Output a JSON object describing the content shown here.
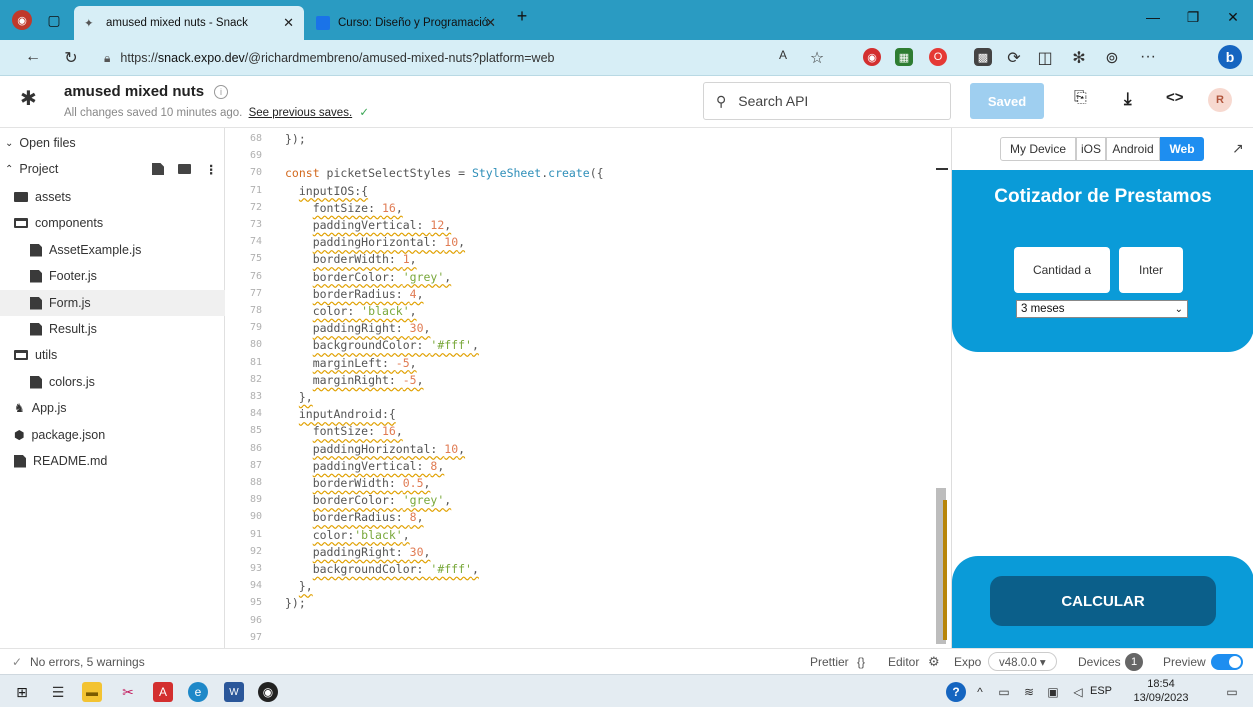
{
  "browser": {
    "tabs": [
      {
        "title": "amused mixed nuts - Snack",
        "active": true
      },
      {
        "title": "Curso: Diseño y Programación de",
        "active": false
      }
    ],
    "new_tab": "+",
    "url_prefix": "https://",
    "url_host": "snack.expo.dev",
    "url_path": "/@richardmembreno/amused-mixed-nuts?platform=web",
    "more": "···"
  },
  "app": {
    "title": "amused mixed nuts",
    "save_status": "All changes saved 10 minutes ago.",
    "see_previous": "See previous saves.",
    "search_placeholder": "Search API",
    "saved_label": "Saved",
    "avatar": "R"
  },
  "sidebar": {
    "open_files": "Open files",
    "project": "Project",
    "items": [
      {
        "label": "assets",
        "kind": "folder"
      },
      {
        "label": "components",
        "kind": "folder-open"
      },
      {
        "label": "AssetExample.js",
        "kind": "file"
      },
      {
        "label": "Footer.js",
        "kind": "file"
      },
      {
        "label": "Form.js",
        "kind": "file",
        "selected": true
      },
      {
        "label": "Result.js",
        "kind": "file"
      },
      {
        "label": "utils",
        "kind": "folder-open"
      },
      {
        "label": "colors.js",
        "kind": "file"
      },
      {
        "label": "App.js",
        "kind": "app"
      },
      {
        "label": "package.json",
        "kind": "pkg"
      },
      {
        "label": "README.md",
        "kind": "file"
      }
    ]
  },
  "editor": {
    "lines": [
      {
        "n": "68",
        "t": "});"
      },
      {
        "n": "69",
        "t": ""
      },
      {
        "n": "70",
        "t": "const picketSelectStyles = StyleSheet.create({"
      },
      {
        "n": "71",
        "t": "  inputIOS:{"
      },
      {
        "n": "72",
        "t": "    fontSize: 16,"
      },
      {
        "n": "73",
        "t": "    paddingVertical: 12,"
      },
      {
        "n": "74",
        "t": "    paddingHorizontal: 10,"
      },
      {
        "n": "75",
        "t": "    borderWidth: 1,"
      },
      {
        "n": "76",
        "t": "    borderColor: 'grey',"
      },
      {
        "n": "77",
        "t": "    borderRadius: 4,"
      },
      {
        "n": "78",
        "t": "    color: 'black',"
      },
      {
        "n": "79",
        "t": "    paddingRight: 30,"
      },
      {
        "n": "80",
        "t": "    backgroundColor: '#fff',"
      },
      {
        "n": "81",
        "t": "    marginLeft: -5,"
      },
      {
        "n": "82",
        "t": "    marginRight: -5,"
      },
      {
        "n": "83",
        "t": "  },"
      },
      {
        "n": "84",
        "t": "  inputAndroid:{"
      },
      {
        "n": "85",
        "t": "    fontSize: 16,"
      },
      {
        "n": "86",
        "t": "    paddingHorizontal: 10,"
      },
      {
        "n": "87",
        "t": "    paddingVertical: 8,"
      },
      {
        "n": "88",
        "t": "    borderWidth: 0.5,"
      },
      {
        "n": "89",
        "t": "    borderColor: 'grey',"
      },
      {
        "n": "90",
        "t": "    borderRadius: 8,"
      },
      {
        "n": "91",
        "t": "    color:'black',"
      },
      {
        "n": "92",
        "t": "    paddingRight: 30,"
      },
      {
        "n": "93",
        "t": "    backgroundColor: '#fff',"
      },
      {
        "n": "94",
        "t": "  },"
      },
      {
        "n": "95",
        "t": "});"
      },
      {
        "n": "96",
        "t": ""
      },
      {
        "n": "97",
        "t": ""
      }
    ]
  },
  "preview": {
    "segments": [
      "My Device",
      "iOS",
      "Android",
      "Web"
    ],
    "active_segment": "Web",
    "app_title": "Cotizador de Prestamos",
    "input_amount": "Cantidad a",
    "input_interest": "Inter",
    "select_value": "3 meses",
    "button": "CALCULAR"
  },
  "status": {
    "problems": "No errors, 5 warnings",
    "prettier": "Prettier",
    "prettier_icon": "{}",
    "editor": "Editor",
    "expo": "Expo",
    "version": "v48.0.0 ▾",
    "devices": "Devices",
    "devices_count": "1",
    "preview": "Preview"
  },
  "taskbar": {
    "lang": "ESP",
    "time": "18:54",
    "date": "13/09/2023"
  },
  "colors": {
    "accent": "#0a9bd8",
    "tab_bar": "#2a9bc2",
    "button_dark": "#0b5f8a"
  }
}
